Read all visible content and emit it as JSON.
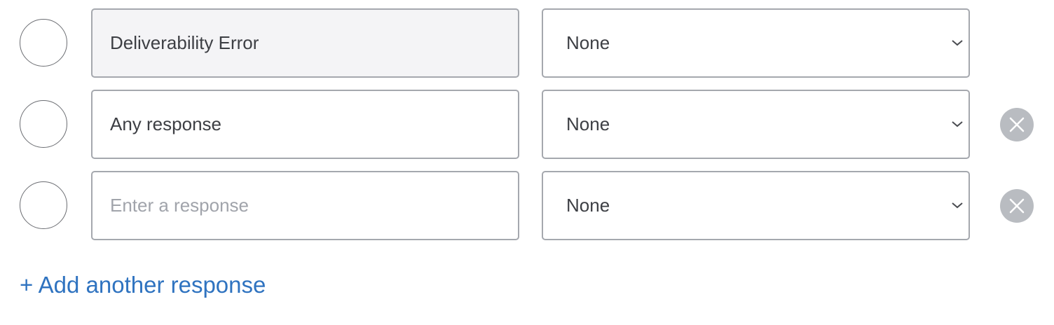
{
  "responses": [
    {
      "value": "Deliverability Error",
      "placeholder": "",
      "readonly": true,
      "select_value": "None",
      "removable": false
    },
    {
      "value": "Any response",
      "placeholder": "",
      "readonly": false,
      "select_value": "None",
      "removable": true
    },
    {
      "value": "",
      "placeholder": "Enter a response",
      "readonly": false,
      "select_value": "None",
      "removable": true
    }
  ],
  "add_link_label": "+ Add another response",
  "colors": {
    "border": "#a5a8ae",
    "readonly_bg": "#f4f4f6",
    "remove_button": "#b9bcc1",
    "link": "#2f73c0",
    "text": "#3d3f44",
    "placeholder": "#a1a4ab"
  },
  "icons": {
    "select": "chevron-down-icon",
    "remove": "close-icon"
  }
}
